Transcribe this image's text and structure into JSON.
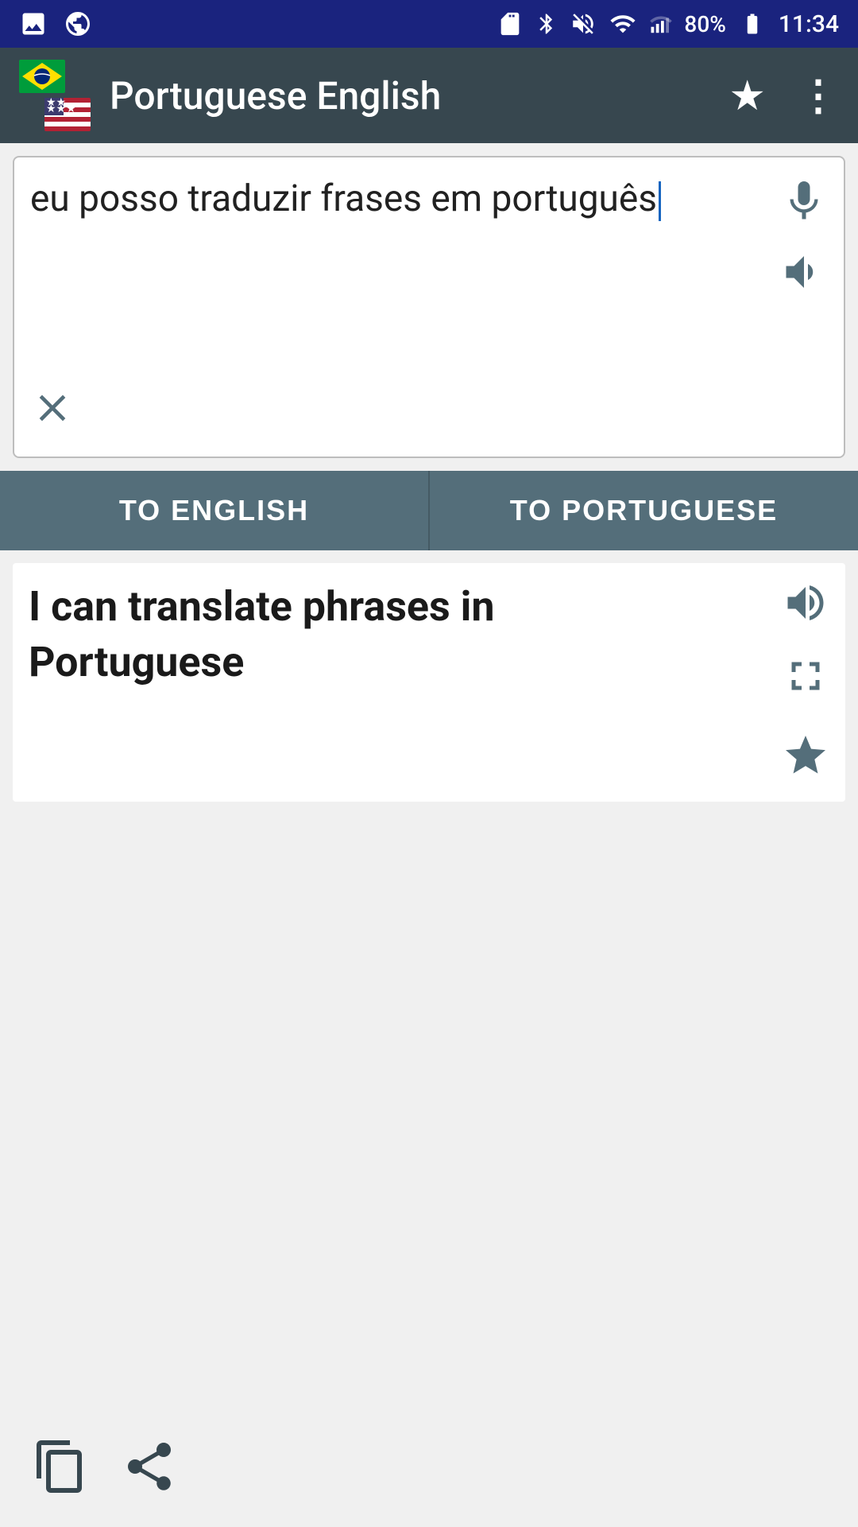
{
  "statusBar": {
    "battery": "80%",
    "time": "11:34"
  },
  "appBar": {
    "title": "Portuguese English",
    "favoriteIcon": "★",
    "moreIcon": "⋮"
  },
  "inputArea": {
    "text": "eu posso traduzir frases em português",
    "micIcon": "mic",
    "speakerIcon": "speaker",
    "clearIcon": "close"
  },
  "buttons": {
    "toEnglish": "TO ENGLISH",
    "toPortuguese": "TO PORTUGUESE"
  },
  "result": {
    "text": "I can translate phrases in Portuguese",
    "speakerIcon": "speaker",
    "expandIcon": "expand",
    "starIcon": "star"
  },
  "bottomActions": {
    "copyIcon": "copy",
    "shareIcon": "share"
  }
}
